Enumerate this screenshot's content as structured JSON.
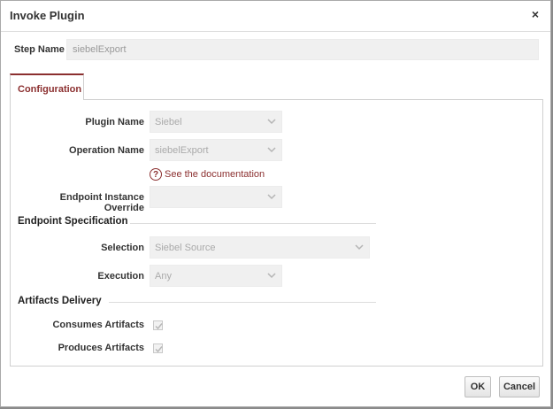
{
  "dialog": {
    "title": "Invoke Plugin",
    "close_icon": "close-icon",
    "close_glyph": "×"
  },
  "step": {
    "label": "Step Name",
    "value": "siebelExport"
  },
  "tabs": [
    {
      "label": "Configuration",
      "active": true
    }
  ],
  "form": {
    "plugin_name": {
      "label": "Plugin Name",
      "value": "Siebel"
    },
    "operation_name": {
      "label": "Operation Name",
      "value": "siebelExport"
    },
    "documentation_link": "See the documentation",
    "endpoint_override": {
      "label": "Endpoint Instance Override",
      "value": ""
    },
    "endpoint_spec": {
      "heading": "Endpoint Specification",
      "selection": {
        "label": "Selection",
        "value": "Siebel Source"
      },
      "execution": {
        "label": "Execution",
        "value": "Any"
      }
    },
    "artifacts": {
      "heading": "Artifacts Delivery",
      "consumes": {
        "label": "Consumes Artifacts",
        "checked": true
      },
      "produces": {
        "label": "Produces Artifacts",
        "checked": true
      }
    }
  },
  "buttons": {
    "ok": "OK",
    "cancel": "Cancel"
  },
  "colors": {
    "accent": "#8b2f2f",
    "disabled_field": "#f0f0f0"
  }
}
